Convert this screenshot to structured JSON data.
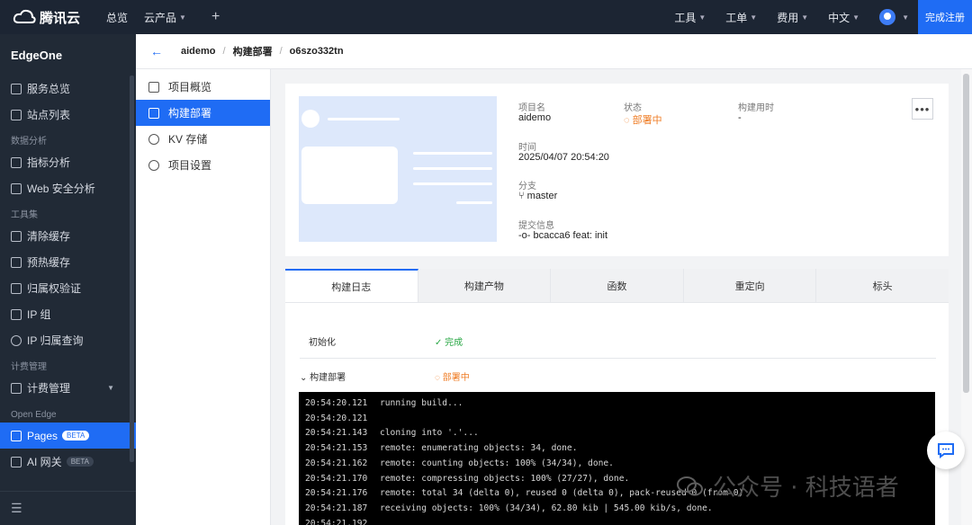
{
  "topbar": {
    "logo_text": "腾讯云",
    "overview": "总览",
    "products": "云产品",
    "plus": "+",
    "tools": "工具",
    "tickets": "工单",
    "billing": "费用",
    "language": "中文",
    "register": "完成注册"
  },
  "sidebar": {
    "product": "EdgeOne",
    "items_top": [
      "服务总览",
      "站点列表"
    ],
    "group_analytics": "数据分析",
    "items_analytics": [
      "指标分析",
      "Web 安全分析"
    ],
    "group_tools": "工具集",
    "items_tools": [
      "清除缓存",
      "预热缓存",
      "归属权验证",
      "IP 组",
      "IP 归属查询"
    ],
    "group_billing": "计费管理",
    "billing_item": "计费管理",
    "group_open": "Open Edge",
    "pages": "Pages",
    "pages_badge": "BETA",
    "ai_gateway": "AI 网关",
    "ai_badge": "BETA"
  },
  "breadcrumb": {
    "back": "←",
    "project": "aidemo",
    "section": "构建部署",
    "deploy_id": "o6szo332tn"
  },
  "submenu": {
    "items": [
      "项目概览",
      "构建部署",
      "KV 存储",
      "项目设置"
    ]
  },
  "deploy": {
    "project_label": "项目名",
    "project_value": "aidemo",
    "status_label": "状态",
    "status_value": "部署中",
    "duration_label": "构建用时",
    "duration_value": "-",
    "time_label": "时间",
    "time_value": "2025/04/07 20:54:20",
    "branch_label": "分支",
    "branch_value": "master",
    "commit_label": "提交信息",
    "commit_value": "bcacca6 feat: init",
    "more": "•••"
  },
  "tabs": [
    "构建日志",
    "构建产物",
    "函数",
    "重定向",
    "标头"
  ],
  "steps": [
    {
      "name": "初始化",
      "status": "完成"
    },
    {
      "name": "构建部署",
      "status": "部署中"
    }
  ],
  "log": [
    {
      "time": "20:54:20.121",
      "msg": "running build..."
    },
    {
      "time": "20:54:20.121",
      "msg": ""
    },
    {
      "time": "20:54:21.143",
      "msg": "cloning into '.'..."
    },
    {
      "time": "20:54:21.153",
      "msg": "remote: enumerating objects: 34, done."
    },
    {
      "time": "20:54:21.162",
      "msg": "remote: counting objects: 100% (34/34), done."
    },
    {
      "time": "20:54:21.170",
      "msg": "remote: compressing objects: 100% (27/27), done."
    },
    {
      "time": "20:54:21.176",
      "msg": "remote: total 34 (delta 0), reused 0 (delta 0), pack-reused 0 (from 0)"
    },
    {
      "time": "20:54:21.187",
      "msg": "receiving objects: 100% (34/34), 62.80 kib | 545.00 kib/s, done."
    },
    {
      "time": "20:54:21.192",
      "msg": ""
    }
  ],
  "watermark": "公众号 · 科技语者"
}
